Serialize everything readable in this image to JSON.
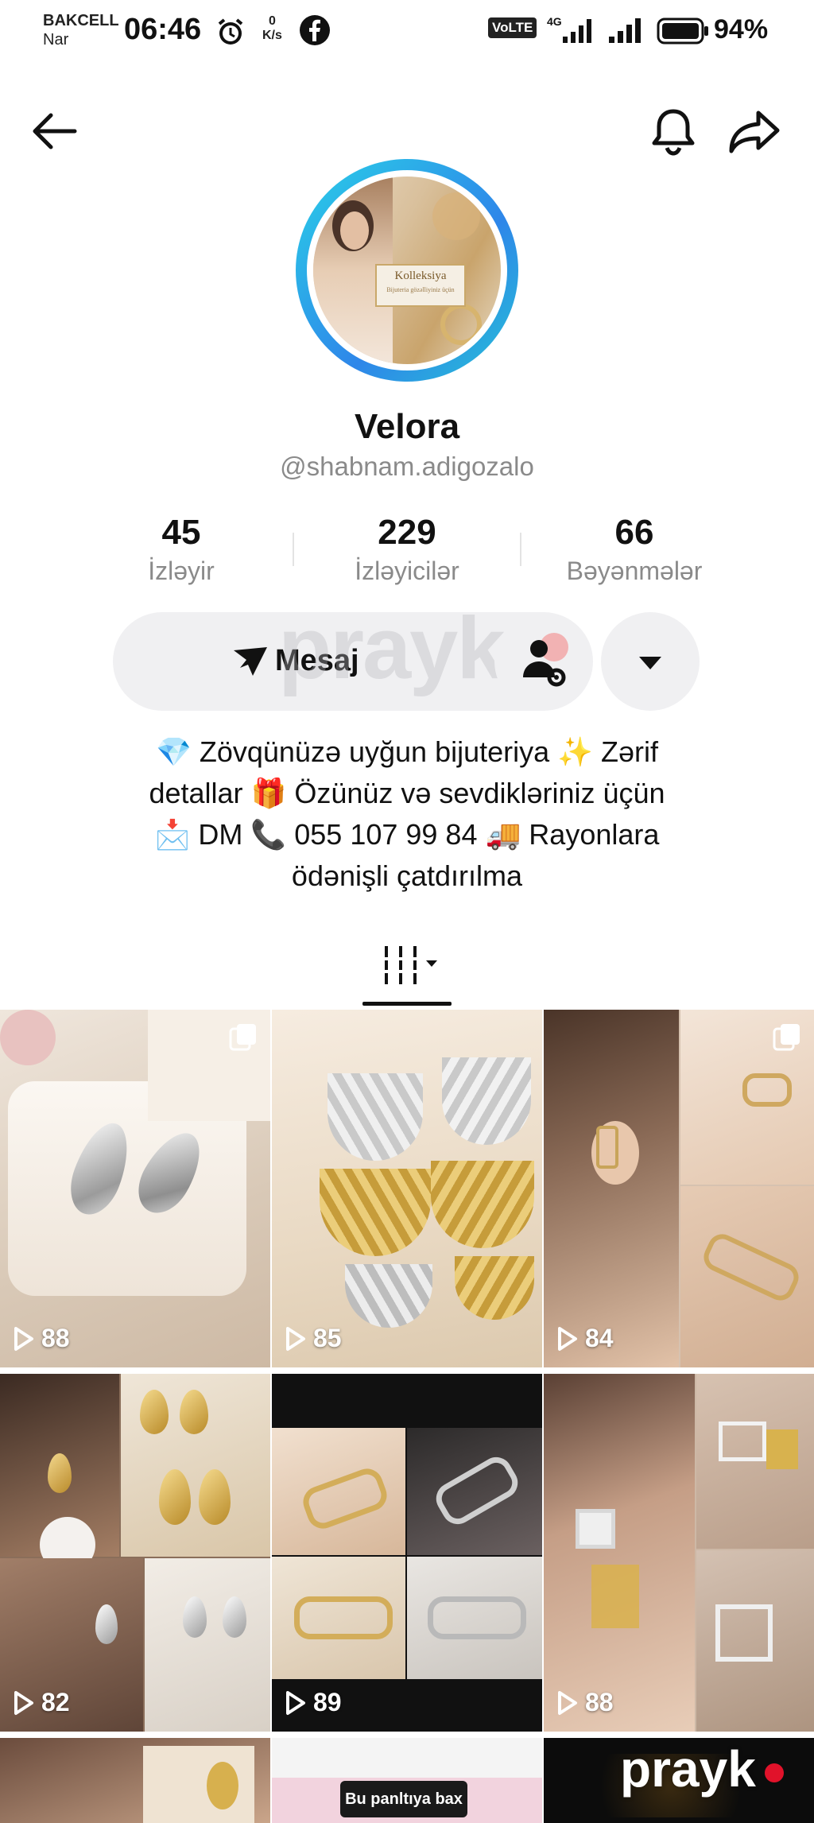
{
  "status_bar": {
    "carrier_line1": "BAKCELL",
    "carrier_line2": "Nar",
    "time": "06:46",
    "speed_value": "0",
    "speed_unit": "K/s",
    "volte": "VoLTE",
    "battery_pct": "94%"
  },
  "profile": {
    "avatar_label": "Kolleksiya",
    "avatar_sublabel": "Bijuteria gözəlliyiniz üçün",
    "name": "Velora",
    "handle": "@shabnam.adigozalo"
  },
  "stats": [
    {
      "value": "45",
      "label": "İzləyir"
    },
    {
      "value": "229",
      "label": "İzləyicilər"
    },
    {
      "value": "66",
      "label": "Bəyənmələr"
    }
  ],
  "actions": {
    "message_label": "Mesaj"
  },
  "bio": {
    "line1": "💎 Zövqünüzə uyğun bijuteriya ✨ Zərif",
    "line2": "detallar 🎁 Özünüz və sevdikləriniz üçün",
    "line3": "📩 DM 📞 055 107 99 84 🚚 Rayonlara",
    "line4": "ödənişli çatdırılma"
  },
  "videos": [
    {
      "views": "88"
    },
    {
      "views": "85"
    },
    {
      "views": "84"
    },
    {
      "views": "82"
    },
    {
      "views": "89"
    },
    {
      "views": "88"
    }
  ],
  "partial_row": {
    "ad_label": "Bu panltıya bax"
  },
  "watermark": {
    "text": "prayk"
  },
  "colors": {
    "ring_start": "#2ad0e8",
    "ring_end": "#2e86e9",
    "accent_red": "#e1122a"
  }
}
